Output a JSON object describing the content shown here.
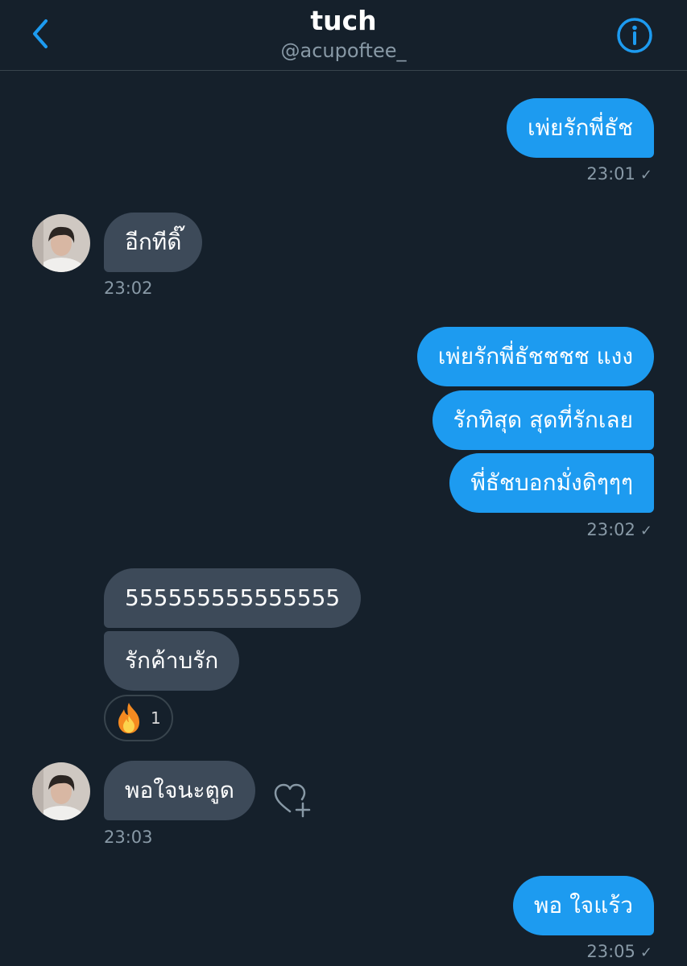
{
  "header": {
    "name": "tuch",
    "handle": "@acupoftee_"
  },
  "colors": {
    "background": "#15202b",
    "outgoing_bubble": "#1d9bf0",
    "incoming_bubble": "#3d4a59",
    "accent": "#1d9bf0",
    "muted_text": "#8899a6"
  },
  "icons": {
    "back": "back-chevron-icon",
    "info": "info-icon",
    "check": "check-icon",
    "reaction": "fire-emoji",
    "like": "heart-plus-icon"
  },
  "messages": [
    {
      "direction": "outgoing",
      "text": "เพ่ยรักพี่ธัช"
    },
    {
      "direction": "outgoing",
      "time": "23:01",
      "check": "✓"
    },
    {
      "direction": "incoming",
      "text": "อีกทีดิ๊"
    },
    {
      "direction": "incoming",
      "time": "23:02"
    },
    {
      "direction": "outgoing",
      "text": "เพ่ยรักพี่ธัชชชช แงง"
    },
    {
      "direction": "outgoing",
      "text": "รักทิสุด สุดที่รักเลย"
    },
    {
      "direction": "outgoing",
      "text": "พี่ธัชบอกมั่งดิๆๆๆ"
    },
    {
      "direction": "outgoing",
      "time": "23:02",
      "check": "✓"
    },
    {
      "direction": "incoming",
      "text": "555555555555555"
    },
    {
      "direction": "incoming",
      "text": "รักค้าบรัก"
    },
    {
      "direction": "incoming",
      "reaction_count": "1"
    },
    {
      "direction": "incoming",
      "text": "พอใจนะตูด"
    },
    {
      "direction": "incoming",
      "time": "23:03"
    },
    {
      "direction": "outgoing",
      "text": "พอ ใจแร้ว"
    },
    {
      "direction": "outgoing",
      "time": "23:05",
      "check": "✓"
    }
  ]
}
